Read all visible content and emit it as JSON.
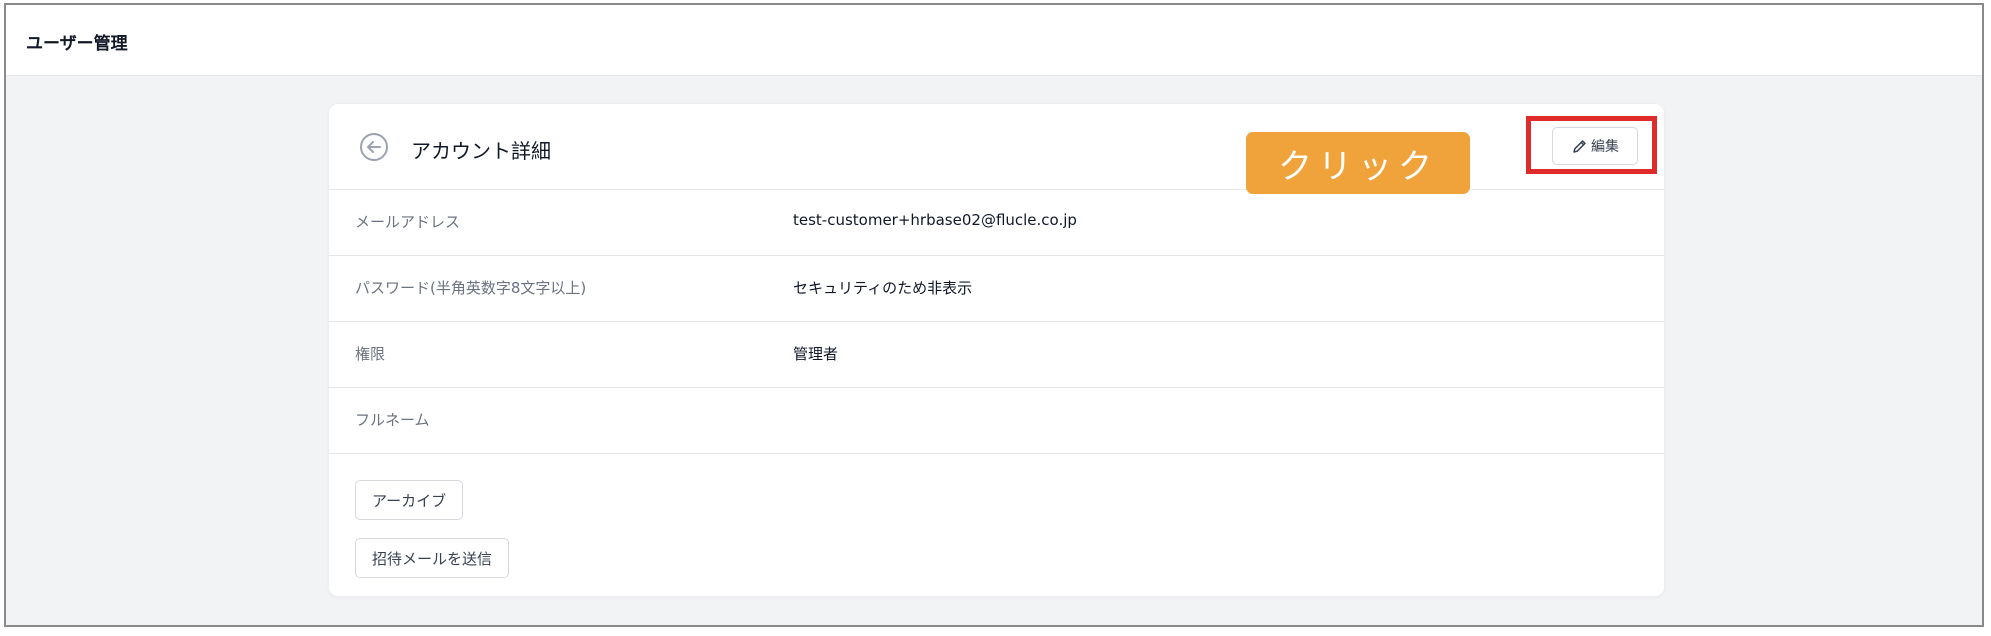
{
  "header": {
    "title": "ユーザー管理"
  },
  "card": {
    "title": "アカウント詳細",
    "edit_label": "編集",
    "fields": [
      {
        "label": "メールアドレス",
        "value": "test-customer+hrbase02@flucle.co.jp"
      },
      {
        "label": "パスワード(半角英数字8文字以上)",
        "value": "セキュリティのため非表示"
      },
      {
        "label": "権限",
        "value": "管理者"
      },
      {
        "label": "フルネーム",
        "value": ""
      }
    ],
    "archive_label": "アーカイブ",
    "send_invite_label": "招待メールを送信"
  },
  "annotation": {
    "callout_text": "クリック",
    "callout_color": "#f0a33a",
    "highlight_color": "#e02b2b"
  }
}
